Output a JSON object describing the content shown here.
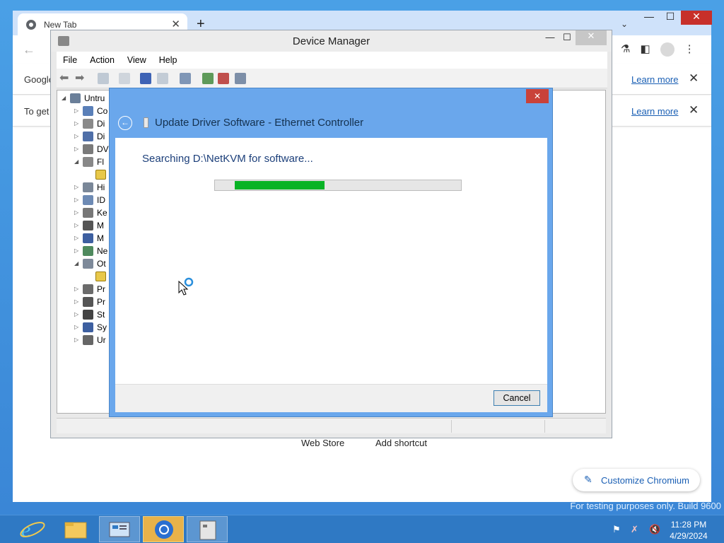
{
  "chromium": {
    "tab_title": "New Tab",
    "new_tab": "+",
    "minimize": "—",
    "maximize": "☐",
    "close": "✕",
    "tab_list": "⌄",
    "infobar1": {
      "text": "Google",
      "learn_more": "Learn more"
    },
    "infobar2": {
      "text": "To get",
      "learn_more": "Learn more"
    },
    "shortcuts": [
      "Web Store",
      "Add shortcut"
    ],
    "customize_label": "Customize Chromium"
  },
  "devmgr": {
    "title": "Device Manager",
    "minimize": "—",
    "maximize": "☐",
    "close": "✕",
    "menu": [
      "File",
      "Action",
      "View",
      "Help"
    ],
    "tree": [
      {
        "label": "Untru",
        "arrow": "◢",
        "depth": 0
      },
      {
        "label": "Co",
        "arrow": "▷",
        "depth": 1
      },
      {
        "label": "Di",
        "arrow": "▷",
        "depth": 1
      },
      {
        "label": "Di",
        "arrow": "▷",
        "depth": 1
      },
      {
        "label": "DV",
        "arrow": "▷",
        "depth": 1
      },
      {
        "label": "Fl",
        "arrow": "◢",
        "depth": 1
      },
      {
        "label": "",
        "arrow": "",
        "depth": 2
      },
      {
        "label": "Hi",
        "arrow": "▷",
        "depth": 1
      },
      {
        "label": "ID",
        "arrow": "▷",
        "depth": 1
      },
      {
        "label": "Ke",
        "arrow": "▷",
        "depth": 1
      },
      {
        "label": "M",
        "arrow": "▷",
        "depth": 1
      },
      {
        "label": "M",
        "arrow": "▷",
        "depth": 1
      },
      {
        "label": "Ne",
        "arrow": "▷",
        "depth": 1
      },
      {
        "label": "Ot",
        "arrow": "◢",
        "depth": 1
      },
      {
        "label": "",
        "arrow": "",
        "depth": 2
      },
      {
        "label": "Pr",
        "arrow": "▷",
        "depth": 1
      },
      {
        "label": "Pr",
        "arrow": "▷",
        "depth": 1
      },
      {
        "label": "St",
        "arrow": "▷",
        "depth": 1
      },
      {
        "label": "Sy",
        "arrow": "▷",
        "depth": 1
      },
      {
        "label": "Ur",
        "arrow": "▷",
        "depth": 1
      }
    ]
  },
  "dialog": {
    "title": "Update Driver Software - Ethernet Controller",
    "close": "✕",
    "back": "←",
    "status_text": "Searching D:\\NetKVM for software...",
    "progress_start": 0.08,
    "progress_fraction": 0.365,
    "cancel_label": "Cancel"
  },
  "desktop": {
    "watermark": "For testing purposes only. Build 9600"
  },
  "taskbar": {
    "time": "11:28 PM",
    "date": "4/29/2024"
  },
  "colors": {
    "progress_fill": "#07b325",
    "dialog_frame": "#6aa7ec",
    "taskbar": "#2f79c4",
    "link": "#1a5fb4"
  }
}
